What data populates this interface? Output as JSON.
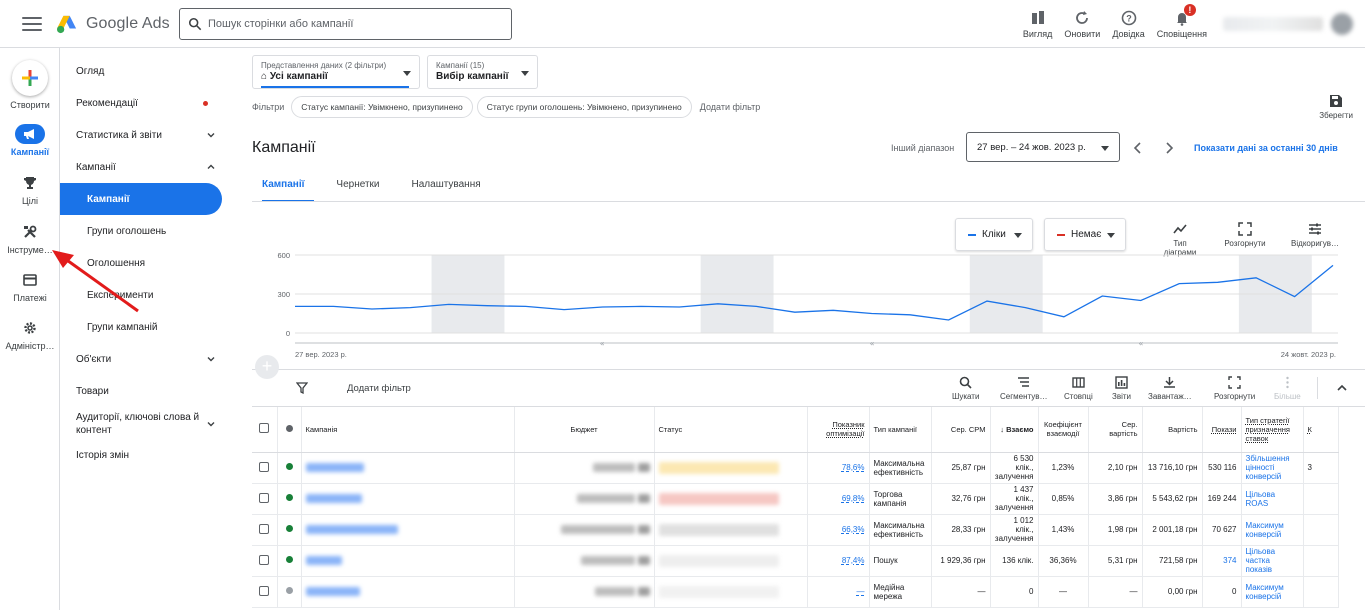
{
  "app": {
    "name": "Google Ads"
  },
  "search": {
    "placeholder": "Пошук сторінки або кампанії"
  },
  "top_actions": [
    {
      "label": "Вигляд",
      "icon": "view-icon"
    },
    {
      "label": "Оновити",
      "icon": "refresh-icon"
    },
    {
      "label": "Довідка",
      "icon": "help-icon"
    },
    {
      "label": "Сповіщення",
      "icon": "bell-icon",
      "badge": "!"
    }
  ],
  "rail": {
    "create": "Створити",
    "campaigns": "Кампанії",
    "goals": "Цілі",
    "tools": "Інструме…",
    "billing": "Платежі",
    "admin": "Адміністр…"
  },
  "nav": {
    "overview": "Огляд",
    "recommendations": "Рекомендації",
    "insights": "Статистика й звіти",
    "campaigns_group": "Кампанії",
    "campaigns": "Кампанії",
    "ad_groups": "Групи оголошень",
    "ads": "Оголошення",
    "experiments": "Експерименти",
    "campaign_groups": "Групи кампаній",
    "assets": "Об'єкти",
    "products": "Товари",
    "audiences": "Аудиторії, ключові слова й контент",
    "change_history": "Історія змін"
  },
  "view_dd": {
    "small": "Представлення даних (2 фільтри)",
    "value": "Усі кампанії"
  },
  "campaign_dd": {
    "small": "Кампанії (15)",
    "value": "Вибір кампанії"
  },
  "filters": {
    "label": "Фільтри",
    "chips": [
      "Статус кампанії: Увімкнено, призупинено",
      "Статус групи оголошень: Увімкнено, призупинено"
    ],
    "add": "Додати фільтр"
  },
  "save_label": "Зберегти",
  "page_title": "Кампанії",
  "date": {
    "label": "Інший діапазон",
    "range": "27 вер. – 24 жов. 2023 р.",
    "last30": "Показати дані за останні 30 днів"
  },
  "tabs": [
    "Кампанії",
    "Чернетки",
    "Налаштування"
  ],
  "metric1": {
    "label": "Кліки",
    "color": "#1a73e8"
  },
  "metric2": {
    "label": "Немає",
    "color": "#d93025"
  },
  "chart_tools": {
    "type": "Тип діаграми",
    "expand": "Розгорнути",
    "adjust": "Відкоригув…"
  },
  "chart_data": {
    "type": "line",
    "series": [
      {
        "name": "Кліки",
        "values": [
          205,
          205,
          185,
          195,
          220,
          210,
          205,
          180,
          200,
          205,
          200,
          225,
          205,
          160,
          175,
          150,
          140,
          100,
          245,
          195,
          125,
          285,
          250,
          380,
          390,
          425,
          280,
          520
        ]
      }
    ],
    "ylim": [
      0,
      600
    ],
    "yticks": [
      "600",
      "300",
      "0"
    ],
    "x_start": "27 вер. 2023 р.",
    "x_end": "24 жовт. 2023 р.",
    "weekend_bands": [
      [
        4,
        5
      ],
      [
        11,
        12
      ],
      [
        18,
        19
      ],
      [
        25,
        26
      ]
    ]
  },
  "toolbar": {
    "add_filter": "Додати фільтр",
    "search": "Шукати",
    "segment": "Сегментув…",
    "columns": "Стовпці",
    "reports": "Звіти",
    "download": "Завантаж…",
    "expand": "Розгорнути",
    "more": "Більше"
  },
  "table": {
    "headers": {
      "campaign": "Кампанія",
      "budget": "Бюджет",
      "status": "Статус",
      "opt_score": "Показник оптимізації",
      "type": "Тип кампанії",
      "avg_cpm": "Сер. CPM",
      "interactions": "Взаємо",
      "int_rate": "Коефіцієнт взаємодії",
      "avg_cost": "Сер. вартість",
      "cost": "Вартість",
      "impr": "Покази",
      "bid_strategy": "Тип стратегії призначення ставок",
      "extra": "К"
    },
    "rows": [
      {
        "status_dot": "#188038",
        "opt": "78,6%",
        "type": "Максимальна ефективність",
        "cpm": "25,87 грн",
        "inter": "6 530 клік., залучення",
        "rate": "1,23%",
        "avgc": "2,10 грн",
        "cost": "13 716,10 грн",
        "impr": "530 116",
        "impr_link": false,
        "bid": "Збільшення цінності конверсій",
        "extra": "3",
        "status_color": "#fce8b2"
      },
      {
        "status_dot": "#188038",
        "opt": "69,8%",
        "type": "Торгова кампанія",
        "cpm": "32,76 грн",
        "inter": "1 437 клік., залучення",
        "rate": "0,85%",
        "avgc": "3,86 грн",
        "cost": "5 543,62 грн",
        "impr": "169 244",
        "impr_link": false,
        "bid": "Цільова ROAS",
        "extra": "",
        "status_color": "#f6c7c3"
      },
      {
        "status_dot": "#188038",
        "opt": "66,3%",
        "type": "Максимальна ефективність",
        "cpm": "28,33 грн",
        "inter": "1 012 клік., залучення",
        "rate": "1,43%",
        "avgc": "1,98 грн",
        "cost": "2 001,18 грн",
        "impr": "70 627",
        "impr_link": false,
        "bid": "Максимум конверсій",
        "extra": "",
        "status_color": "#e0e0e0"
      },
      {
        "status_dot": "#188038",
        "opt": "87,4%",
        "type": "Пошук",
        "cpm": "1 929,36 грн",
        "inter": "136 клік.",
        "rate": "36,36%",
        "avgc": "5,31 грн",
        "cost": "721,58 грн",
        "impr": "374",
        "impr_link": true,
        "bid": "Цільова частка показів",
        "extra": "",
        "status_color": "#eeeeee"
      },
      {
        "status_dot": "#9aa0a6",
        "opt": "—",
        "type": "Медійна мережа",
        "cpm": "—",
        "inter": "0",
        "rate": "—",
        "avgc": "—",
        "cost": "0,00 грн",
        "impr": "0",
        "impr_link": false,
        "bid": "Максимум конверсій",
        "extra": "",
        "status_color": "#f1f1f1"
      }
    ]
  }
}
